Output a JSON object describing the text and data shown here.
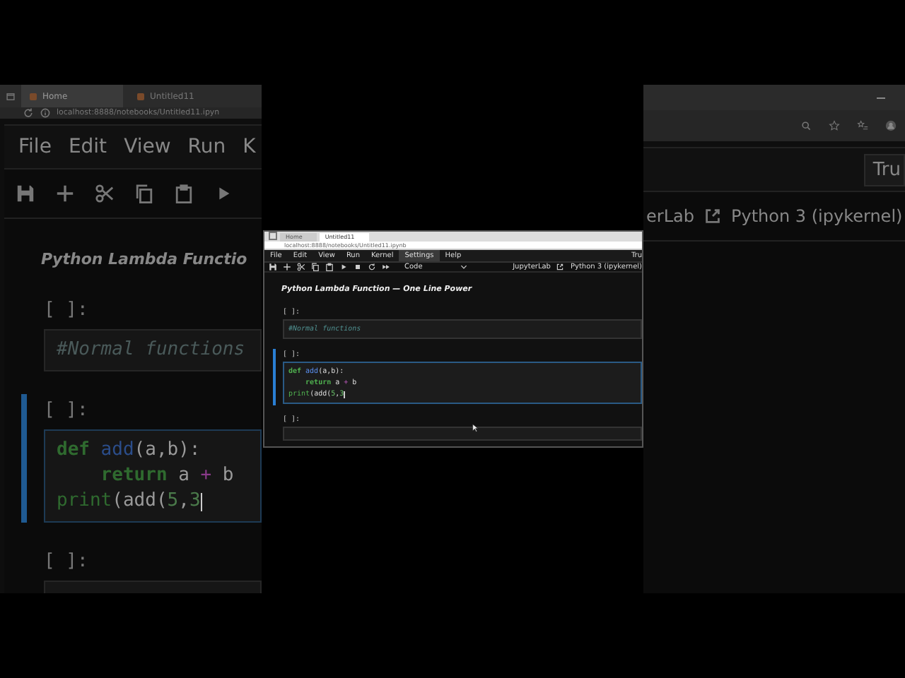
{
  "background_left": {
    "tabs": [
      {
        "label": "Home",
        "selected": true
      },
      {
        "label": "Untitled11",
        "selected": false
      }
    ],
    "url": "localhost:8888/notebooks/Untitled11.ipyn",
    "menu": [
      "File",
      "Edit",
      "View",
      "Run",
      "K"
    ],
    "title": "Python Lambda Functio",
    "cells": [
      {
        "prompt": "[ ]:",
        "active": false,
        "lines": [
          [
            {
              "text": "#Normal functions",
              "kind": "comment"
            }
          ]
        ]
      },
      {
        "prompt": "[ ]:",
        "active": true,
        "lines": [
          [
            {
              "text": "def",
              "kind": "keyword"
            },
            {
              "text": " add",
              "kind": "function"
            },
            {
              "text": "(a,b):",
              "kind": "plain"
            }
          ],
          [
            {
              "text": "    return",
              "kind": "keyword"
            },
            {
              "text": " a ",
              "kind": "plain"
            },
            {
              "text": "+",
              "kind": "operator"
            },
            {
              "text": " b",
              "kind": "plain"
            }
          ],
          [
            {
              "text": "print",
              "kind": "builtin"
            },
            {
              "text": "(add(",
              "kind": "plain"
            },
            {
              "text": "5",
              "kind": "number"
            },
            {
              "text": ",",
              "kind": "plain"
            },
            {
              "text": "3",
              "kind": "number"
            }
          ]
        ]
      },
      {
        "prompt": "[ ]:",
        "active": false
      }
    ]
  },
  "background_right": {
    "trust": "Tru",
    "launcher": "erLab",
    "kernel": "Python 3 (ipykernel)"
  },
  "inset_window": {
    "tabs": [
      {
        "label": "Home",
        "selected": false
      },
      {
        "label": "Untitled11",
        "selected": true
      }
    ],
    "url": "localhost:8888/notebooks/Untitled11.ipynb",
    "menu": [
      {
        "label": "File",
        "selected": false
      },
      {
        "label": "Edit",
        "selected": false
      },
      {
        "label": "View",
        "selected": false
      },
      {
        "label": "Run",
        "selected": false
      },
      {
        "label": "Kernel",
        "selected": false
      },
      {
        "label": "Settings",
        "selected": true
      },
      {
        "label": "Help",
        "selected": false
      }
    ],
    "trust": "Tru",
    "cell_type": "Code",
    "launcher": "JupyterLab",
    "kernel": "Python 3 (ipykernel)",
    "title": "Python Lambda Function — One Line Power",
    "cells": [
      {
        "prompt": "[ ]:",
        "active": false,
        "lines": [
          [
            {
              "text": "#Normal functions",
              "kind": "comment"
            }
          ]
        ]
      },
      {
        "prompt": "[ ]:",
        "active": true,
        "lines": [
          [
            {
              "text": "def",
              "kind": "keyword"
            },
            {
              "text": " add",
              "kind": "function"
            },
            {
              "text": "(a,b):",
              "kind": "plain"
            }
          ],
          [
            {
              "text": "    return",
              "kind": "keyword"
            },
            {
              "text": " a ",
              "kind": "plain"
            },
            {
              "text": "+",
              "kind": "operator"
            },
            {
              "text": " b",
              "kind": "plain"
            }
          ],
          [
            {
              "text": "print",
              "kind": "builtin"
            },
            {
              "text": "(add(",
              "kind": "plain"
            },
            {
              "text": "5",
              "kind": "number"
            },
            {
              "text": ",",
              "kind": "plain"
            },
            {
              "text": "3",
              "kind": "number"
            }
          ]
        ]
      },
      {
        "prompt": "[ ]:",
        "active": false
      }
    ]
  }
}
